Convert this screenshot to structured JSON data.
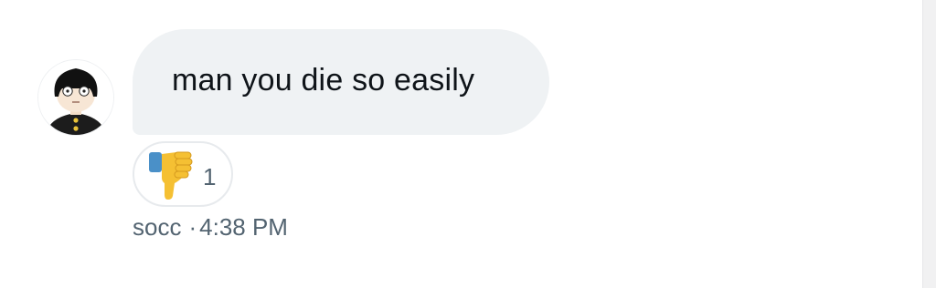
{
  "message": {
    "text": "man you die so easily",
    "sender": "socc",
    "separator": "·",
    "timestamp": "4:38 PM"
  },
  "reaction": {
    "emoji_icon": "thumbs-down-icon",
    "count": "1"
  },
  "avatar": {
    "icon": "avatar-cartoon-boy"
  },
  "colors": {
    "bubble_bg": "#eff2f4",
    "text": "#0f1419",
    "meta_text": "#536471",
    "reaction_border": "#e7eaed",
    "emoji_yellow": "#f5c033"
  }
}
